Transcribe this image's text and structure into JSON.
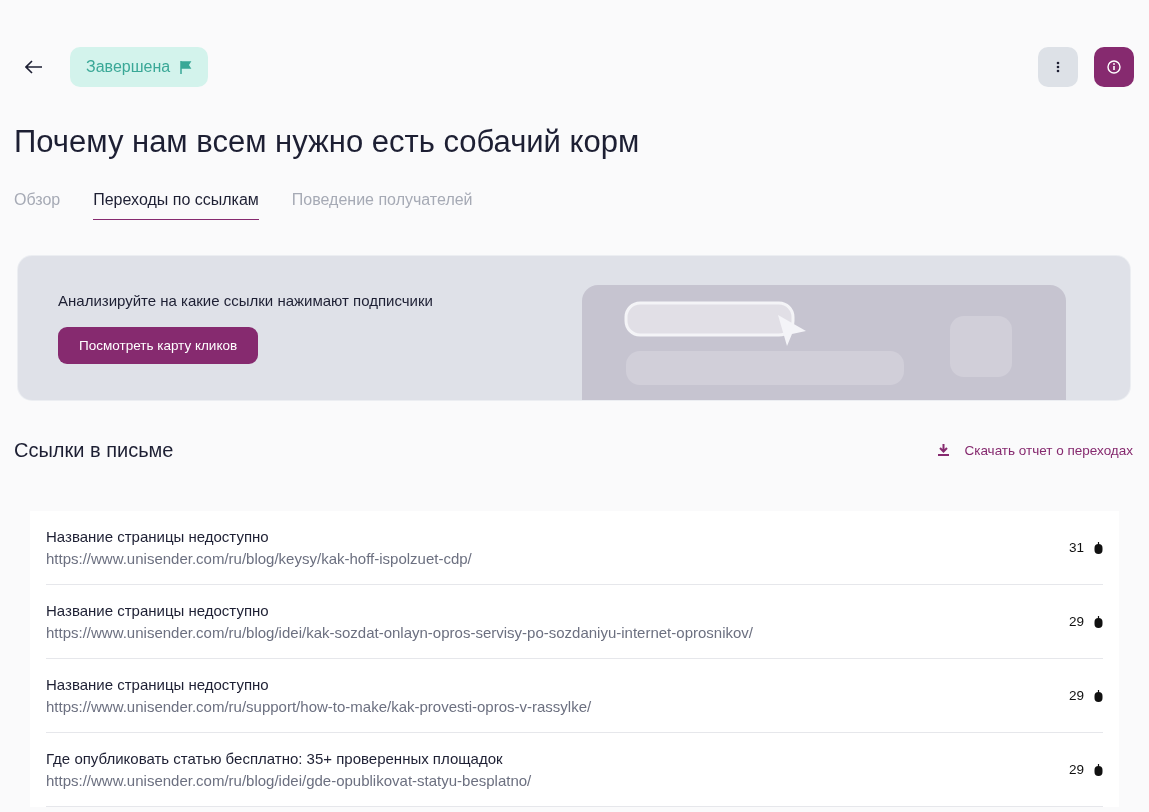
{
  "status_badge": {
    "label": "Завершена"
  },
  "title": "Почему нам всем нужно есть собачий корм",
  "tabs": [
    {
      "label": "Обзор",
      "selected": false
    },
    {
      "label": "Переходы по ссылкам",
      "selected": true
    },
    {
      "label": "Поведение получателей",
      "selected": false
    }
  ],
  "banner": {
    "text": "Анализируйте на какие ссылки нажимают подписчики",
    "button": "Посмотреть карту кликов"
  },
  "links_section": {
    "heading": "Ссылки в письме",
    "download": "Скачать отчет о переходах"
  },
  "links": [
    {
      "title": "Название страницы недоступно",
      "url": "https://www.unisender.com/ru/blog/keysy/kak-hoff-ispolzuet-cdp/",
      "clicks": "31"
    },
    {
      "title": "Название страницы недоступно",
      "url": "https://www.unisender.com/ru/blog/idei/kak-sozdat-onlayn-opros-servisy-po-sozdaniyu-internet-oprosnikov/",
      "clicks": "29"
    },
    {
      "title": "Название страницы недоступно",
      "url": "https://www.unisender.com/ru/support/how-to-make/kak-provesti-opros-v-rassylke/",
      "clicks": "29"
    },
    {
      "title": "Где опубликовать статью бесплатно: 35+ проверенных площадок",
      "url": "https://www.unisender.com/ru/blog/idei/gde-opublikovat-statyu-besplatno/",
      "clicks": "29"
    }
  ]
}
